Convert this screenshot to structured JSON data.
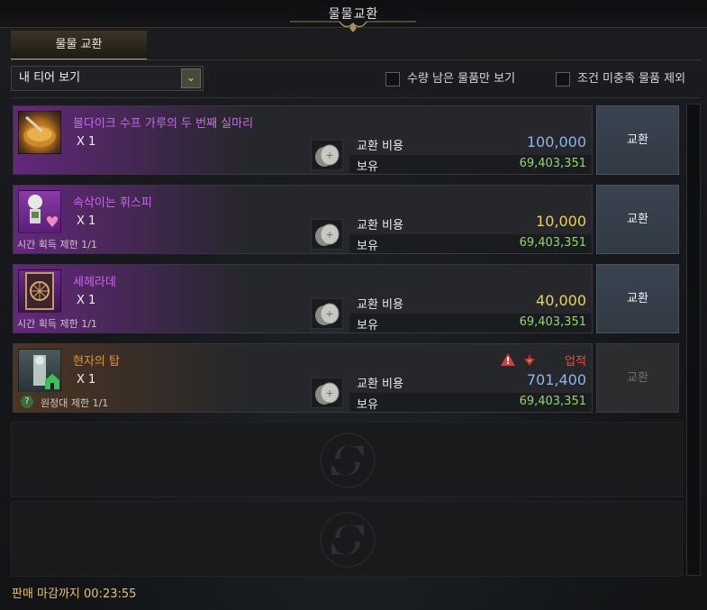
{
  "window": {
    "title": "물물교환"
  },
  "tab": {
    "label": "물물 교환"
  },
  "filter": {
    "tier_select": "내 티어 보기",
    "checkbox_remaining": "수량 남은 물품만 보기",
    "checkbox_exclude": "조건 미충족 물품 제외"
  },
  "labels": {
    "cost": "교환 비용",
    "own": "보유",
    "exchange": "교환"
  },
  "items": [
    {
      "name": "볼다이크 수프 가루의 두 번째 실마리",
      "qty": "X 1",
      "limit": "",
      "cost": "100,000",
      "own": "69,403,351",
      "name_color": "#c86ae8",
      "cost_color": "#8fb4e8",
      "icon": "soup-bowl-icon"
    },
    {
      "name": "속삭이는 휘스피",
      "qty": "X 1",
      "limit": "시간 획득 제한 1/1",
      "cost": "10,000",
      "own": "69,403,351",
      "name_color": "#c86ae8",
      "cost_color": "#e6d35a",
      "icon": "whisper-doll-icon"
    },
    {
      "name": "세헤라데",
      "qty": "X 1",
      "limit": "시간 획득 제한 1/1",
      "cost": "40,000",
      "own": "69,403,351",
      "name_color": "#c86ae8",
      "cost_color": "#e6d35a",
      "icon": "card-icon"
    },
    {
      "name": "현자의 탑",
      "qty": "X 1",
      "limit": "원정대 제한 1/1",
      "cost": "701,400",
      "own": "69,403,351",
      "name_color": "#e8903a",
      "cost_color": "#8fb4e8",
      "icon": "tower-icon",
      "achievement": "업적"
    }
  ],
  "footer": {
    "deadline": "판매 마감까지 00:23:55"
  }
}
